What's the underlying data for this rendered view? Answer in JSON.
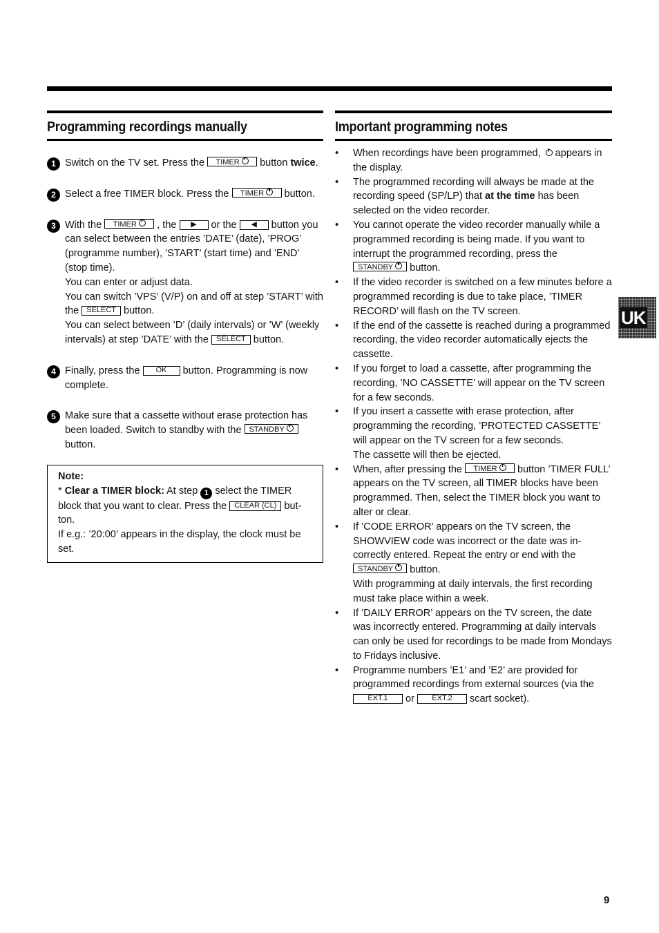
{
  "left": {
    "heading": "Programming recordings manually",
    "steps": [
      {
        "num": "1",
        "pre": "Switch on the TV set. Press the ",
        "key": "TIMER",
        "post": " button ",
        "bold": "twice",
        "end": "."
      },
      {
        "num": "2",
        "pre": "Select a free TIMER block. Press the ",
        "key": "TIMER",
        "post": " button."
      },
      {
        "num": "3",
        "pre": "With the ",
        "key": "TIMER",
        "mid1": " , the ",
        "key2": "▶",
        "mid2": " or the ",
        "key3": "◀",
        "post": " button you can select between the entries ’DATE’ (date), ’PROG’ (programme number), ’START’ (start time) and ’END’ (stop time).",
        "line2": "You can enter or adjust data.",
        "line3a": "You can switch ’VPS’ (V/P) on and off at step ’START’ with the ",
        "line3key": "SELECT",
        "line3b": " button.",
        "line4a": "You can select between ’D’ (daily intervals) or ’W’ (weekly intervals) at step ’DATE’ with the ",
        "line4key": "SELECT",
        "line4b": " button."
      },
      {
        "num": "4",
        "pre": "Finally, press the ",
        "key": "OK",
        "post": " button. Programming is now complete."
      },
      {
        "num": "5",
        "pre": "Make sure that a cassette without erase protection has been loaded. Switch to standby with the ",
        "key": "STANDBY",
        "post": " button."
      }
    ],
    "note": {
      "title": "Note:",
      "star": "* ",
      "bold": "Clear a TIMER block:",
      "a": " At step ",
      "stepnum": "1",
      "b": " select the TIMER block that you want to clear. Press the ",
      "key": "CLEAR (CL)",
      "c": " but-ton.",
      "line2": "If e.g.: ’20:00’ appears in the display, the clock must be set."
    }
  },
  "right": {
    "heading": "Important programming notes",
    "b1a": "When recordings have been programmed, ",
    "b1b": " appears in the display.",
    "b2a": "The programmed recording will always be made at the recording speed (SP/LP) that ",
    "b2bold": "at the time",
    "b2b": " has been selected on the video recorder.",
    "b3a": "You cannot operate the video recorder manually while a programmed recording is being made. If you want to interrupt the programmed recording, press the ",
    "b3key": "STANDBY",
    "b3b": " button.",
    "b4": "If the video recorder is switched on a few minutes before a programmed recording is due to take place, ’TIMER RECORD’ will flash on the TV screen.",
    "b5": "If the end of the cassette is reached during a programmed recording, the video recorder automatically ejects the cassette.",
    "b6": "If you forget to load a cassette, after programming the recording, ’NO CASSETTE’ will appear on the TV screen for a few seconds.",
    "b7a": "If you insert a cassette with erase protection, after programming the recording, ’PROTECTED CASSETTE’ will appear on the TV screen for a few seconds.",
    "b7b": "The cassette will then be ejected.",
    "b8a": "When, after pressing the ",
    "b8key": "TIMER",
    "b8b": " button ’TIMER FULL’ appears on the TV screen, all TIMER blocks have been programmed. Then, select the TIMER block you want to alter or clear.",
    "b9a": "If ’CODE ERROR’ appears on the TV screen, the SHOWVIEW code was incorrect or the date was in-correctly entered. Repeat the entry or end with the ",
    "b9key": "STANDBY",
    "b9b": " button.",
    "b9c": "With programming at daily intervals, the first recording must take place within a week.",
    "b10": "If ’DAILY ERROR’ appears on the TV screen, the date was incorrectly entered. Programming at daily intervals can only be used for recordings to be made from Mondays to Fridays inclusive.",
    "b11a": "Programme numbers ’E1’ and ’E2’ are provided for programmed recordings from external sources (via the ",
    "b11key1": "EXT.1",
    "b11or": " or ",
    "b11key2": "EXT.2",
    "b11b": " scart socket)."
  },
  "side_tab": "UK",
  "page_number": "9"
}
